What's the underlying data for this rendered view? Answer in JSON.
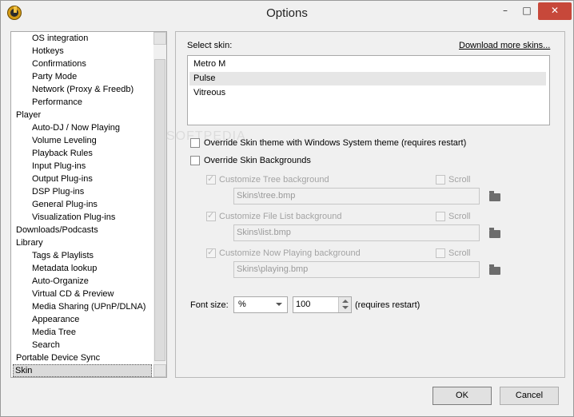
{
  "window": {
    "title": "Options",
    "minimize": "–",
    "maximize": "□",
    "close": "✕"
  },
  "tree": {
    "items": [
      {
        "label": "OS integration",
        "indent": 1
      },
      {
        "label": "Hotkeys",
        "indent": 1
      },
      {
        "label": "Confirmations",
        "indent": 1
      },
      {
        "label": "Party Mode",
        "indent": 1
      },
      {
        "label": "Network (Proxy & Freedb)",
        "indent": 1
      },
      {
        "label": "Performance",
        "indent": 1
      },
      {
        "label": "Player",
        "indent": 0
      },
      {
        "label": "Auto-DJ / Now Playing",
        "indent": 1
      },
      {
        "label": "Volume Leveling",
        "indent": 1
      },
      {
        "label": "Playback Rules",
        "indent": 1
      },
      {
        "label": "Input Plug-ins",
        "indent": 1
      },
      {
        "label": "Output Plug-ins",
        "indent": 1
      },
      {
        "label": "DSP Plug-ins",
        "indent": 1
      },
      {
        "label": "General Plug-ins",
        "indent": 1
      },
      {
        "label": "Visualization Plug-ins",
        "indent": 1
      },
      {
        "label": "Downloads/Podcasts",
        "indent": 0
      },
      {
        "label": "Library",
        "indent": 0
      },
      {
        "label": "Tags & Playlists",
        "indent": 1
      },
      {
        "label": "Metadata lookup",
        "indent": 1
      },
      {
        "label": "Auto-Organize",
        "indent": 1
      },
      {
        "label": "Virtual CD & Preview",
        "indent": 1
      },
      {
        "label": "Media Sharing (UPnP/DLNA)",
        "indent": 1
      },
      {
        "label": "Appearance",
        "indent": 1
      },
      {
        "label": "Media Tree",
        "indent": 1
      },
      {
        "label": "Search",
        "indent": 1
      },
      {
        "label": "Portable Device Sync",
        "indent": 0
      },
      {
        "label": "Skin",
        "indent": 0,
        "selected": true
      }
    ]
  },
  "skin": {
    "select_label": "Select skin:",
    "download_link": "Download more skins...",
    "options": [
      "Metro M",
      "Pulse",
      "Vitreous"
    ],
    "selected": "Pulse"
  },
  "override": {
    "system_theme": "Override Skin theme with Windows System theme (requires restart)",
    "backgrounds": "Override Skin Backgrounds"
  },
  "backgrounds": [
    {
      "label": "Customize Tree background",
      "path": "Skins\\tree.bmp",
      "scroll": "Scroll"
    },
    {
      "label": "Customize File List background",
      "path": "Skins\\list.bmp",
      "scroll": "Scroll"
    },
    {
      "label": "Customize Now Playing background",
      "path": "Skins\\playing.bmp",
      "scroll": "Scroll"
    }
  ],
  "font": {
    "label": "Font size:",
    "unit": "%",
    "value": "100",
    "note": "(requires restart)"
  },
  "buttons": {
    "ok": "OK",
    "cancel": "Cancel"
  },
  "watermark": "SOFTPEDIA"
}
